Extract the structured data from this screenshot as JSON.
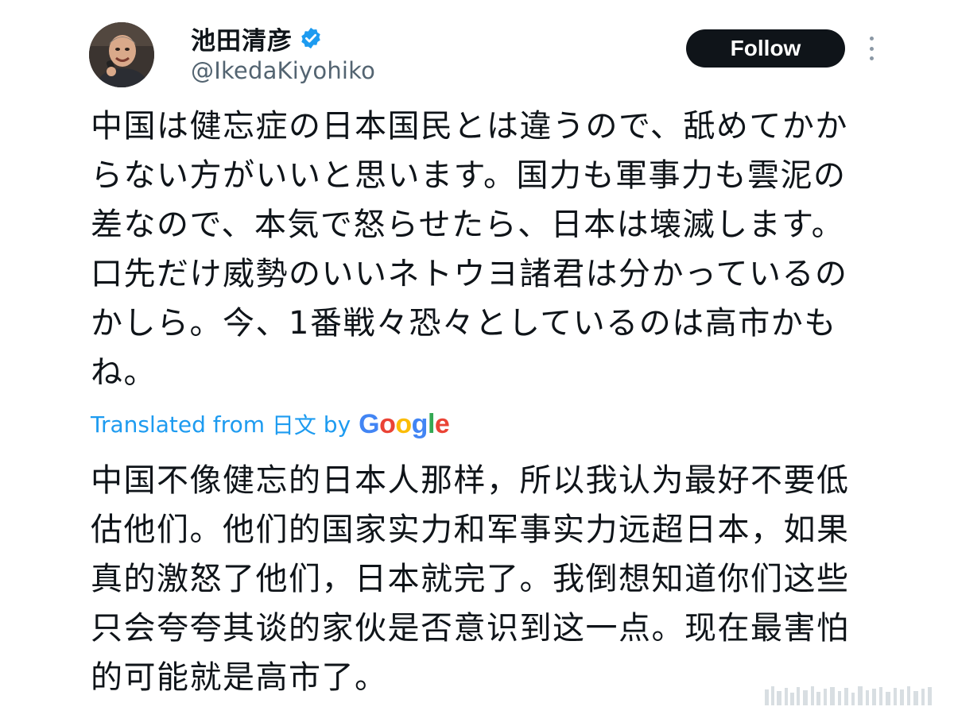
{
  "author": {
    "display_name": "池田清彦",
    "handle": "@IkedaKiyohiko",
    "verified": true,
    "avatar_icon": "person-photo"
  },
  "actions": {
    "follow_label": "Follow",
    "more_icon": "vertical-dots-icon"
  },
  "tweet": {
    "text": "中国は健忘症の日本国民とは違うので、舐めてかからない方がいいと思います。国力も軍事力も雲泥の差なので、本気で怒らせたら、日本は壊滅します。口先だけ威勢のいいネトウヨ諸君は分かっているのかしら。今、1番戦々恐々としているのは高市かもね。"
  },
  "translation": {
    "prefix": "Translated from",
    "language": "日文",
    "by": "by",
    "provider": "Google",
    "text": "中国不像健忘的日本人那样，所以我认为最好不要低估他们。他们的国家实力和军事实力远超日本，如果真的激怒了他们，日本就完了。我倒想知道你们这些只会夸夸其谈的家伙是否意识到这一点。现在最害怕的可能就是高市了。"
  },
  "colors": {
    "accent": "#1d9bf0",
    "text": "#0f1419",
    "secondary": "#536471",
    "follow_bg": "#0f1419",
    "google_blue": "#4285f4",
    "google_red": "#ea4335",
    "google_yellow": "#fbbc05",
    "google_green": "#34a853"
  }
}
